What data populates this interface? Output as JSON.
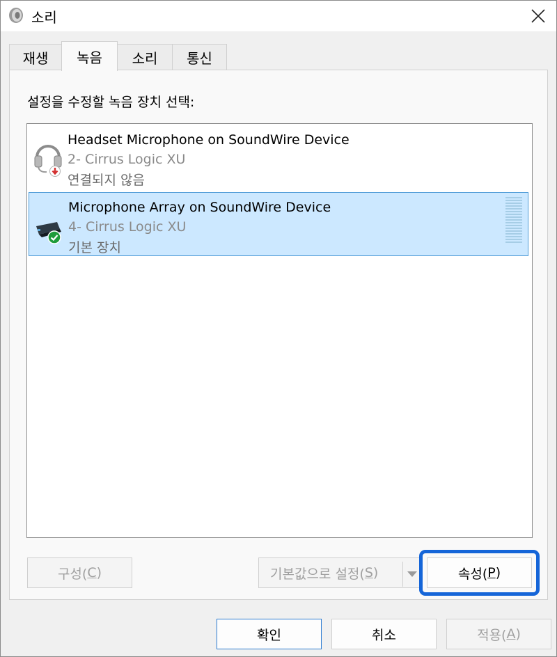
{
  "window": {
    "title": "소리"
  },
  "tabs": [
    {
      "label": "재생"
    },
    {
      "label": "녹음"
    },
    {
      "label": "소리"
    },
    {
      "label": "통신"
    }
  ],
  "instruction": "설정을 수정할 녹음 장치 선택:",
  "devices": [
    {
      "name": "Headset Microphone on SoundWire Device",
      "driver": "2- Cirrus Logic XU",
      "status": "연결되지 않음",
      "icon": "headset-icon",
      "badge": "disconnected-badge"
    },
    {
      "name": "Microphone Array on SoundWire Device",
      "driver": "4- Cirrus Logic XU",
      "status": "기본 장치",
      "icon": "microphone-array-icon",
      "badge": "default-check-badge"
    }
  ],
  "buttons": {
    "configure": {
      "text": "구성(",
      "key": "C",
      "end": ")"
    },
    "set_default": {
      "text": "기본값으로 설정(",
      "key": "S",
      "end": ")"
    },
    "properties": {
      "text": "속성(",
      "key": "P",
      "end": ")"
    },
    "ok": "확인",
    "cancel": "취소",
    "apply": {
      "text": "적용(",
      "key": "A",
      "end": ")"
    }
  },
  "colors": {
    "selection": "#cce8ff",
    "focus": "#1565d8",
    "check": "#1f9b3a",
    "disconnected": "#d32f2f"
  }
}
